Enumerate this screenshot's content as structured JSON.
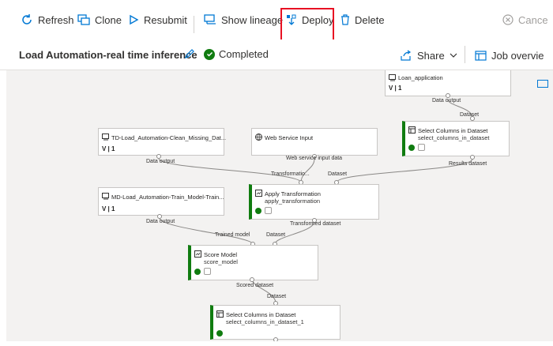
{
  "toolbar": {
    "refresh": "Refresh",
    "clone": "Clone",
    "resubmit": "Resubmit",
    "show_lineage": "Show lineage",
    "deploy": "Deploy",
    "delete": "Delete",
    "cancel": "Cance"
  },
  "header": {
    "title": "Load Automation-real time inference",
    "status": "Completed",
    "share": "Share",
    "job_overview": "Job overvie"
  },
  "nodes": {
    "loan": {
      "title": "Loan_application",
      "version": "V | 1",
      "out_label": "Data output"
    },
    "select1": {
      "in_label": "Dataset",
      "title": "Select Columns in Dataset",
      "sub": "select_columns_in_dataset",
      "out_label": "Results dataset"
    },
    "td": {
      "title": "TD-Load_Automation-Clean_Missing_Dat...",
      "version": "V | 1",
      "out_label": "Data output"
    },
    "wsi": {
      "title": "Web Service Input",
      "out_label": "Web service input data"
    },
    "apply": {
      "in1": "Transformatio...",
      "in2": "Dataset",
      "title": "Apply Transformation",
      "sub": "apply_transformation",
      "out_label": "Transformed dataset"
    },
    "md": {
      "title": "MD-Load_Automation-Train_Model-Train...",
      "version": "V | 1",
      "out_label": "Data output"
    },
    "score": {
      "in1": "Trained model",
      "in2": "Dataset",
      "title": "Score Model",
      "sub": "score_model",
      "out_label": "Scored dataset"
    },
    "select2": {
      "in_label": "Dataset",
      "title": "Select Columns in Dataset",
      "sub": "select_columns_in_dataset_1"
    }
  },
  "colors": {
    "accent": "#0078d4",
    "success": "#107c10",
    "highlight": "#e81123"
  }
}
